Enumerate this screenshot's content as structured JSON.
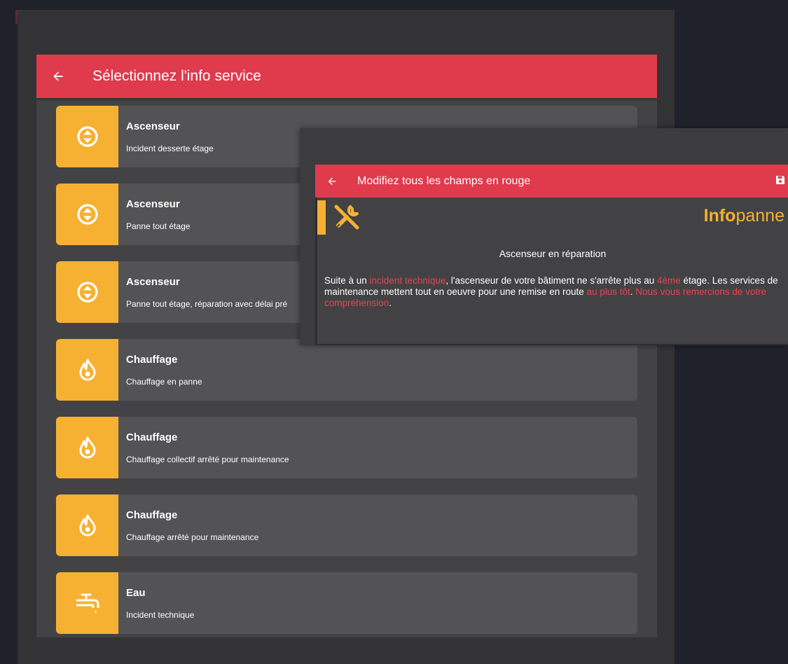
{
  "app_bar": {
    "title": "Sélectionnez l'info service"
  },
  "services": [
    {
      "title": "Ascenseur",
      "subtitle": "Incident desserte étage",
      "icon": "elevator-icon"
    },
    {
      "title": "Ascenseur",
      "subtitle": "Panne tout étage",
      "icon": "elevator-icon"
    },
    {
      "title": "Ascenseur",
      "subtitle": "Panne tout étage, réparation avec délai pré",
      "icon": "elevator-icon"
    },
    {
      "title": "Chauffage",
      "subtitle": "Chauffage en panne",
      "icon": "flame-icon"
    },
    {
      "title": "Chauffage",
      "subtitle": "Chauffage collectif arrêté pour maintenance",
      "icon": "flame-icon"
    },
    {
      "title": "Chauffage",
      "subtitle": "Chauffage arrêté pour maintenance",
      "icon": "flame-icon"
    },
    {
      "title": "Eau",
      "subtitle": "Incident technique",
      "icon": "water-pipe-icon"
    }
  ],
  "dialog": {
    "title": "Modifiez tous les champs en rouge",
    "brand_part1": "Info",
    "brand_part2": "panne",
    "message_title": "Ascenseur en réparation",
    "message": {
      "p1": "Suite à un ",
      "f1": "incident technique",
      "p2": ", l'ascenseur de votre bâtiment ne s'arrête plus au ",
      "f2": "4ème",
      "p3": " étage. Les services de maintenance mettent tout en oeuvre pour une remise en route ",
      "f3": "au plus tôt",
      "p4": ". ",
      "f4": "Nous vous remercions de votre compréhension",
      "p5": "."
    }
  },
  "colors": {
    "accent": "#e03a4d",
    "icon_bg": "#f6b133",
    "highlight": "#e8434f"
  }
}
